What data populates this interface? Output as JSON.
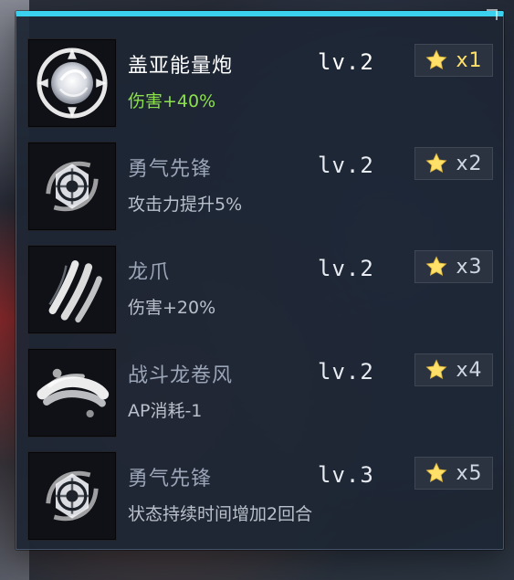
{
  "panel": {
    "accent_color": "#3bd0ee"
  },
  "skills": [
    {
      "icon": "plasma-orb-icon",
      "name": "盖亚能量炮",
      "level": "lv.2",
      "effect": "伤害+40%",
      "star_count": "x1",
      "state": "active"
    },
    {
      "icon": "shield-emblem-icon",
      "name": "勇气先锋",
      "level": "lv.2",
      "effect": "攻击力提升5%",
      "star_count": "x2",
      "state": "inactive"
    },
    {
      "icon": "claw-slash-icon",
      "name": "龙爪",
      "level": "lv.2",
      "effect": "伤害+20%",
      "star_count": "x3",
      "state": "inactive"
    },
    {
      "icon": "tornado-blast-icon",
      "name": "战斗龙卷风",
      "level": "lv.2",
      "effect": "AP消耗-1",
      "star_count": "x4",
      "state": "inactive"
    },
    {
      "icon": "shield-emblem-icon",
      "name": "勇气先锋",
      "level": "lv.3",
      "effect": "状态持续时间增加2回合",
      "star_count": "x5",
      "state": "inactive"
    }
  ],
  "colors": {
    "active_effect": "#8be04b",
    "star_fill": "#ffe16a"
  }
}
